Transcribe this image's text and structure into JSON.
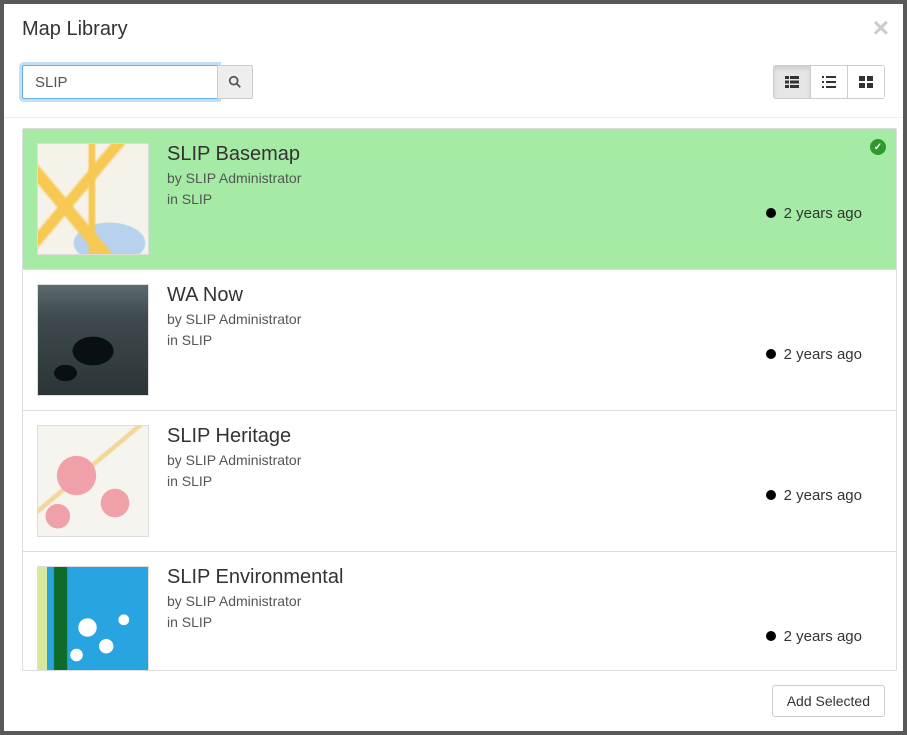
{
  "header": {
    "title": "Map Library"
  },
  "search": {
    "value": "SLIP",
    "placeholder": ""
  },
  "items": [
    {
      "title": "SLIP Basemap",
      "author": "by SLIP Administrator",
      "collection": "in SLIP",
      "time": "2 years ago",
      "selected": true,
      "thumbClass": "thumb-basemap"
    },
    {
      "title": "WA Now",
      "author": "by SLIP Administrator",
      "collection": "in SLIP",
      "time": "2 years ago",
      "selected": false,
      "thumbClass": "thumb-wanow"
    },
    {
      "title": "SLIP Heritage",
      "author": "by SLIP Administrator",
      "collection": "in SLIP",
      "time": "2 years ago",
      "selected": false,
      "thumbClass": "thumb-heritage"
    },
    {
      "title": "SLIP Environmental",
      "author": "by SLIP Administrator",
      "collection": "in SLIP",
      "time": "2 years ago",
      "selected": false,
      "thumbClass": "thumb-env"
    }
  ],
  "footer": {
    "addSelected": "Add Selected"
  }
}
